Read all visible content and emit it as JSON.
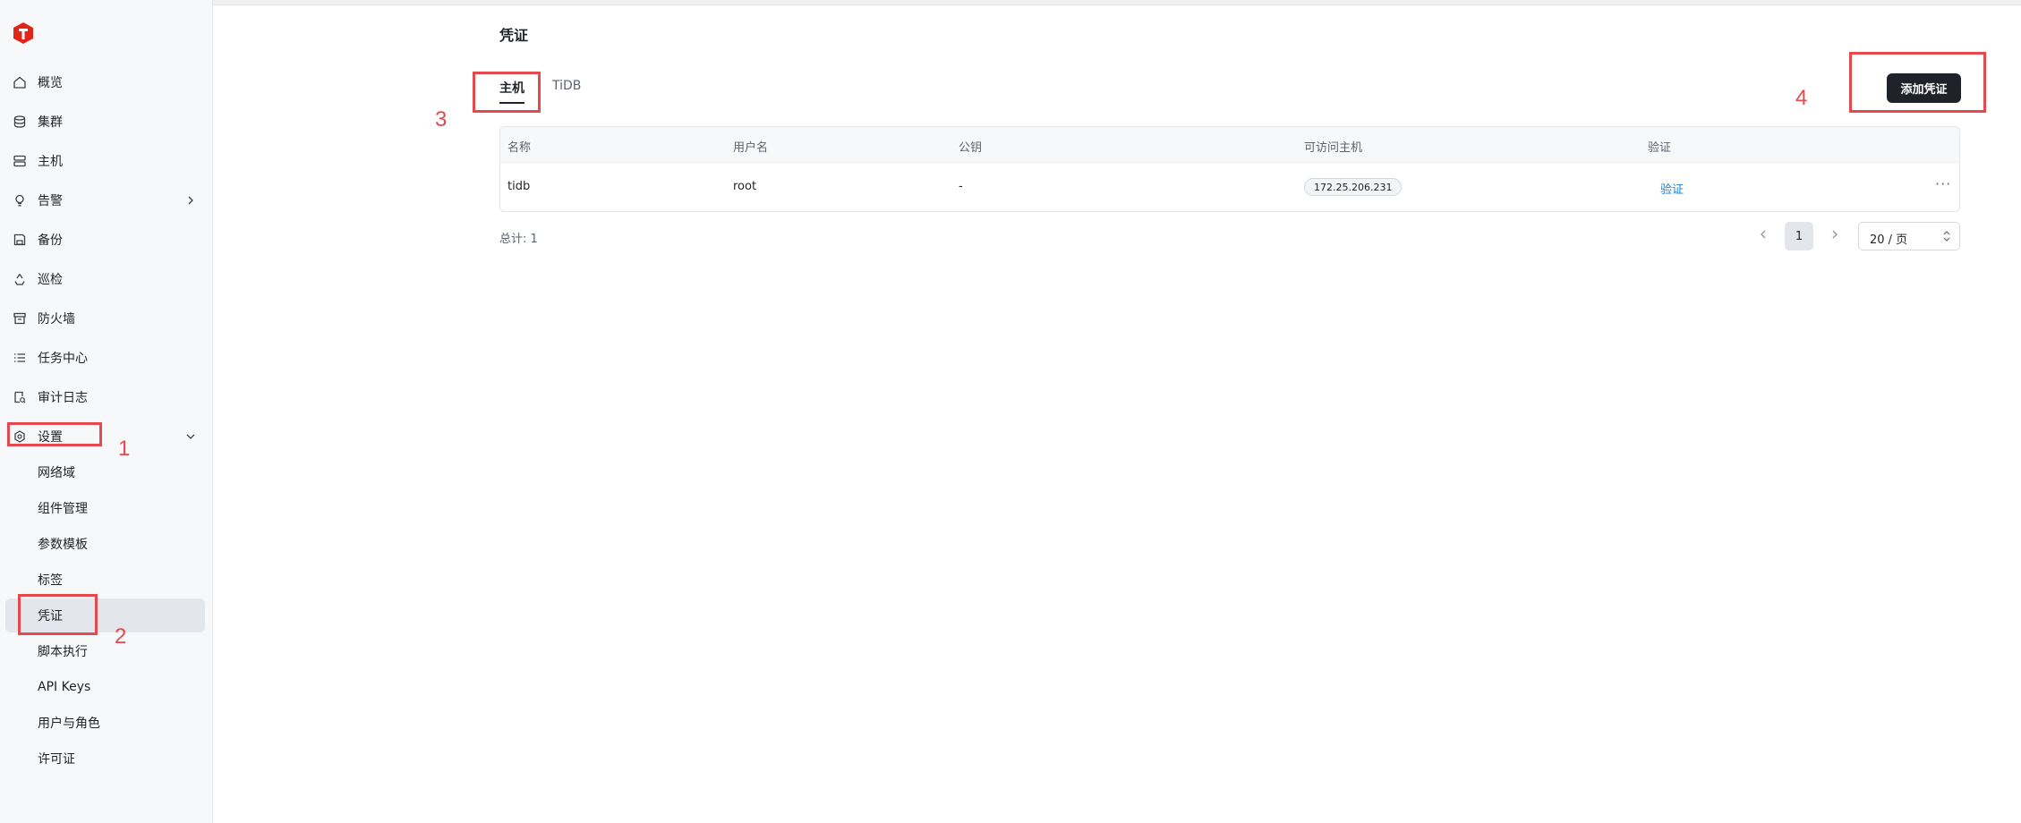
{
  "sidebar": {
    "items": [
      {
        "label": "概览",
        "icon": "home-icon"
      },
      {
        "label": "集群",
        "icon": "database-icon"
      },
      {
        "label": "主机",
        "icon": "server-icon"
      },
      {
        "label": "告警",
        "icon": "bulb-icon"
      },
      {
        "label": "备份",
        "icon": "save-icon"
      },
      {
        "label": "巡检",
        "icon": "recycle-icon"
      },
      {
        "label": "防火墙",
        "icon": "archive-icon"
      },
      {
        "label": "任务中心",
        "icon": "list-icon"
      },
      {
        "label": "审计日志",
        "icon": "audit-icon"
      },
      {
        "label": "设置",
        "icon": "gear-icon"
      }
    ],
    "settings_sub": [
      {
        "label": "网络域"
      },
      {
        "label": "组件管理"
      },
      {
        "label": "参数模板"
      },
      {
        "label": "标签"
      },
      {
        "label": "凭证"
      },
      {
        "label": "脚本执行"
      },
      {
        "label": "API Keys"
      },
      {
        "label": "用户与角色"
      },
      {
        "label": "许可证"
      }
    ]
  },
  "annotations": [
    "1",
    "2",
    "3",
    "4"
  ],
  "main": {
    "title": "凭证",
    "tabs": [
      {
        "label": "主机"
      },
      {
        "label": "TiDB"
      }
    ],
    "add_button": "添加凭证",
    "table": {
      "columns": [
        "名称",
        "用户名",
        "公钥",
        "可访问主机",
        "验证"
      ],
      "rows": [
        {
          "name": "tidb",
          "username": "root",
          "pubkey": "-",
          "hosts": "172.25.206.231",
          "verify": "验证"
        }
      ]
    },
    "total": "总计: 1",
    "pagination": {
      "current": "1",
      "page_size": "20 / 页"
    }
  },
  "colors": {
    "accent": "#1f2329",
    "link": "#1a7fd4",
    "annotation": "#e5484d"
  }
}
